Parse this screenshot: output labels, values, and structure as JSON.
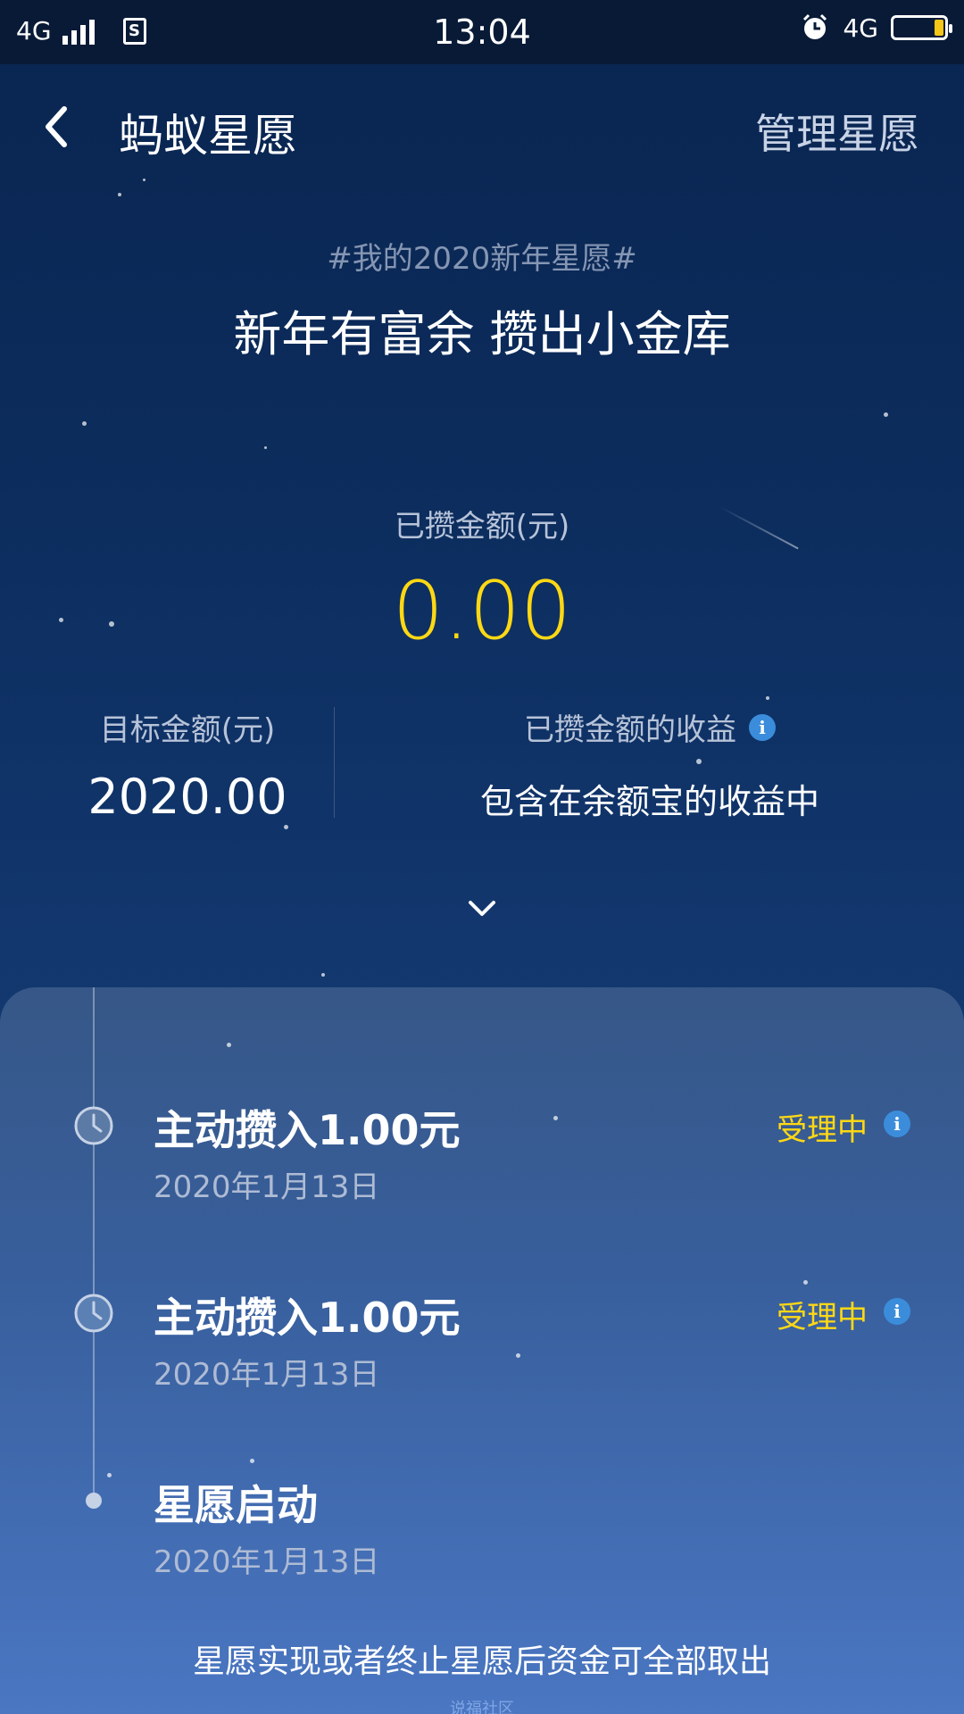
{
  "status_bar": {
    "network_left": "4G",
    "sim_label": "S",
    "time": "13:04",
    "network_right": "4G"
  },
  "nav": {
    "title": "蚂蚁星愿",
    "manage_label": "管理星愿",
    "back_icon": "chevron-left-icon"
  },
  "wish": {
    "tag": "#我的2020新年星愿#",
    "title": "新年有富余 攒出小金库"
  },
  "saved": {
    "label": "已攒金额(元)",
    "amount": "0.00"
  },
  "target": {
    "label": "目标金额(元)",
    "value": "2020.00"
  },
  "earnings": {
    "label": "已攒金额的收益",
    "value": "包含在余额宝的收益中"
  },
  "timeline": [
    {
      "title": "主动攒入1.00元",
      "date": "2020年1月13日",
      "status": "受理中",
      "icon": "clock-icon"
    },
    {
      "title": "主动攒入1.00元",
      "date": "2020年1月13日",
      "status": "受理中",
      "icon": "clock-icon"
    },
    {
      "title": "星愿启动",
      "date": "2020年1月13日",
      "icon": "dot-icon"
    }
  ],
  "footer_note": "星愿实现或者终止星愿后资金可全部取出",
  "watermark": "说福社区",
  "colors": {
    "accent_yellow": "#ffd814",
    "info_blue": "#3b8ddb",
    "background_top": "#0a2550",
    "panel_bottom": "#4a76c2"
  }
}
